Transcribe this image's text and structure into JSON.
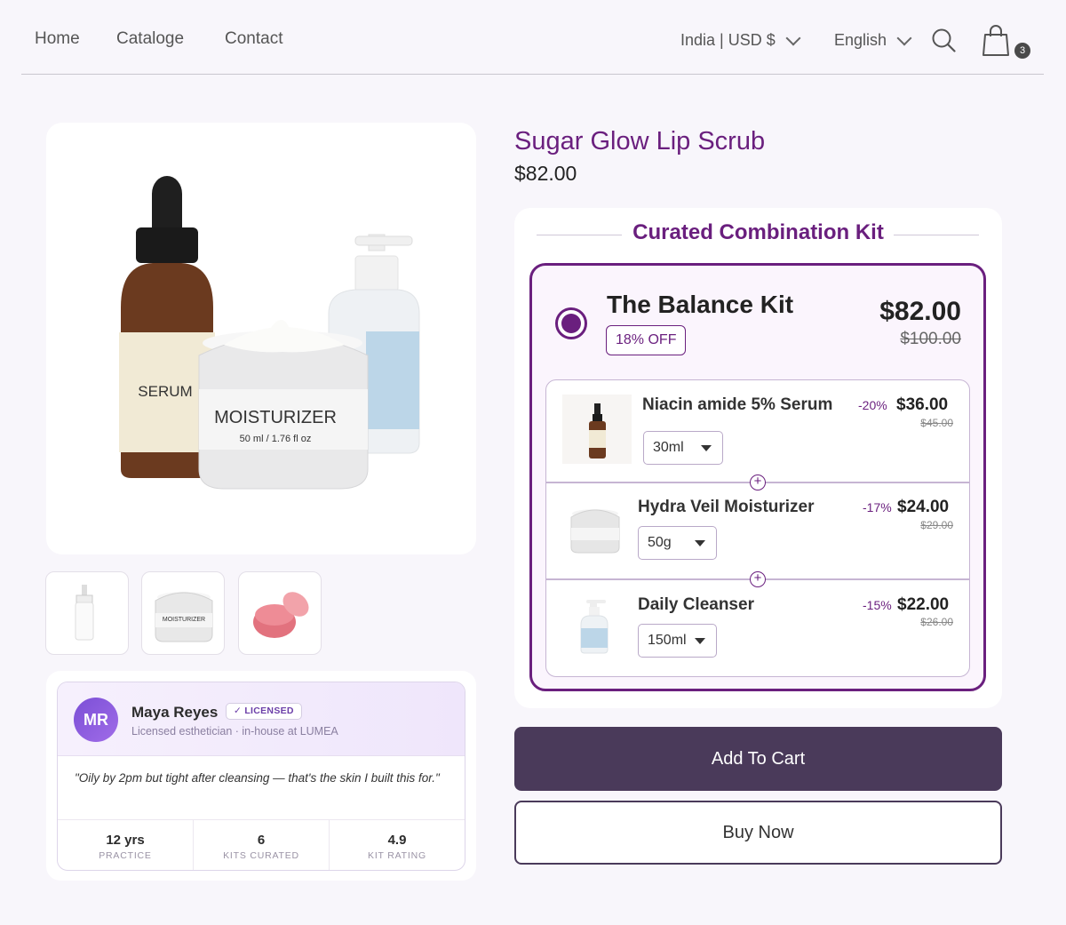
{
  "nav": {
    "links": [
      "Home",
      "Cataloge",
      "Contact"
    ],
    "region": "India | USD $",
    "language": "English",
    "cart_count": "3"
  },
  "gallery": {
    "main_labels": {
      "serum": "SERUM",
      "moisturizer": "MOISTURIZER",
      "moisturizer_size": "50 ml / 1.76 fl oz"
    },
    "thumb_moisturizer_label": "MOISTURIZER"
  },
  "expert": {
    "initials": "MR",
    "name": "Maya Reyes",
    "badge": "✓ LICENSED",
    "subtitle": "Licensed esthetician · in-house at LUMEA",
    "quote": "\"Oily by 2pm but tight after cleansing — that's the skin I built this for.\"",
    "stats": [
      {
        "value": "12 yrs",
        "label": "PRACTICE"
      },
      {
        "value": "6",
        "label": "KITS CURATED"
      },
      {
        "value": "4.9",
        "label": "KIT RATING"
      }
    ]
  },
  "product": {
    "title": "Sugar Glow Lip Scrub",
    "price": "$82.00"
  },
  "kit": {
    "heading": "Curated Combination Kit",
    "name": "The Balance Kit",
    "badge": "18% OFF",
    "price": "$82.00",
    "old_price": "$100.00",
    "items": [
      {
        "name": "Niacin amide 5% Serum",
        "discount": "-20%",
        "price": "$36.00",
        "old_price": "$45.00",
        "variant": "30ml"
      },
      {
        "name": "Hydra Veil Moisturizer",
        "discount": "-17%",
        "price": "$24.00",
        "old_price": "$29.00",
        "variant": "50g"
      },
      {
        "name": "Daily Cleanser",
        "discount": "-15%",
        "price": "$22.00",
        "old_price": "$26.00",
        "variant": "150ml"
      }
    ]
  },
  "actions": {
    "add_to_cart": "Add To Cart",
    "buy_now": "Buy Now"
  },
  "colors": {
    "brand": "#6a1f7e",
    "button_dark": "#4a3a5a",
    "background": "#f8f6fb"
  }
}
